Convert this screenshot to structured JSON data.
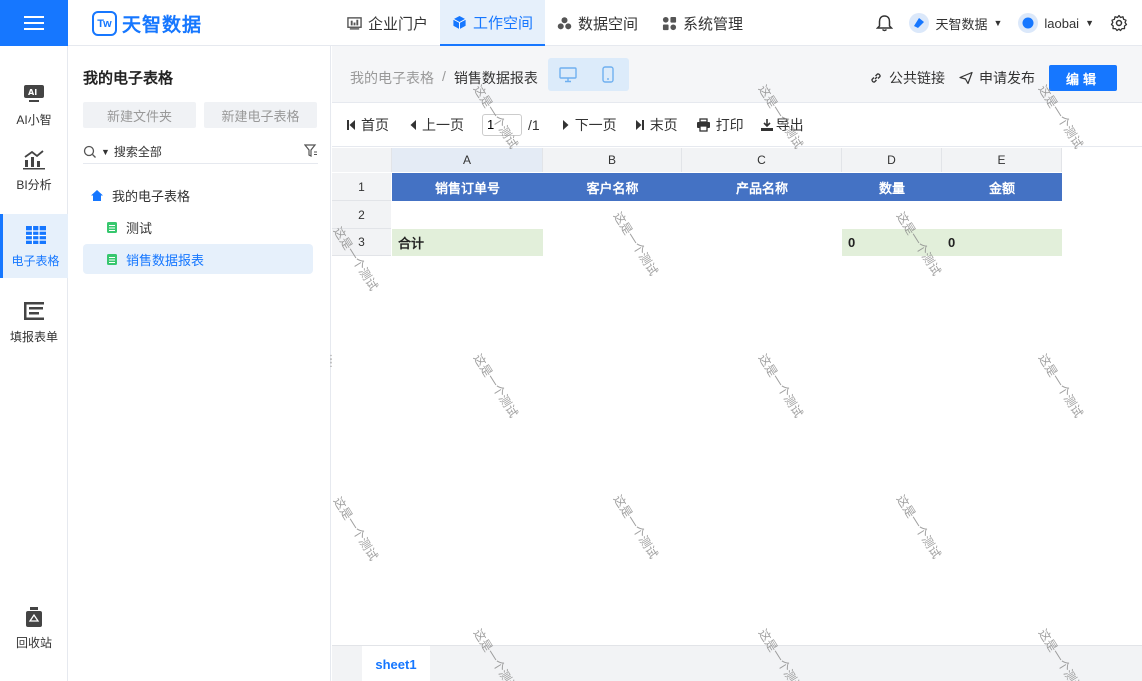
{
  "brand": {
    "logo_mark": "Tw",
    "name": "天智数据"
  },
  "nav": {
    "items": [
      {
        "label": "企业门户",
        "icon": "portal-icon"
      },
      {
        "label": "工作空间",
        "icon": "cube-icon",
        "active": true
      },
      {
        "label": "数据空间",
        "icon": "data-icon"
      },
      {
        "label": "系统管理",
        "icon": "settings-grid-icon"
      }
    ]
  },
  "user": {
    "org": "天智数据",
    "name": "laobai"
  },
  "rail": {
    "items": [
      {
        "label": "AI小智",
        "icon": "ai-icon"
      },
      {
        "label": "BI分析",
        "icon": "chart-icon"
      },
      {
        "label": "电子表格",
        "icon": "table-icon",
        "active": true
      },
      {
        "label": "填报表单",
        "icon": "form-icon"
      },
      {
        "label": "回收站",
        "icon": "recycle-icon"
      }
    ]
  },
  "tree": {
    "title": "我的电子表格",
    "new_folder": "新建文件夹",
    "new_sheet": "新建电子表格",
    "search_scope": "搜索全部",
    "root": "我的电子表格",
    "children": [
      "测试",
      "销售数据报表"
    ]
  },
  "header": {
    "breadcrumb_root": "我的电子表格",
    "breadcrumb_sep": "/",
    "breadcrumb_current": "销售数据报表",
    "public_link": "公共链接",
    "request_publish": "申请发布",
    "edit": "编辑"
  },
  "toolbar": {
    "first": "首页",
    "prev": "上一页",
    "page": "1",
    "total": "/1",
    "next": "下一页",
    "last": "末页",
    "print": "打印",
    "export": "导出"
  },
  "sheet": {
    "columns": [
      "A",
      "B",
      "C",
      "D",
      "E"
    ],
    "rows": [
      "1",
      "2",
      "3"
    ],
    "headers": [
      "销售订单号",
      "客户名称",
      "产品名称",
      "数量",
      "金额"
    ],
    "total_label": "合计",
    "total_qty": "0",
    "total_amount": "0",
    "watermark": "这是一个测试",
    "tab": "sheet1"
  },
  "colors": {
    "accent": "#1677ff",
    "header_fill": "#4472c4",
    "total_fill": "#e2efda"
  }
}
